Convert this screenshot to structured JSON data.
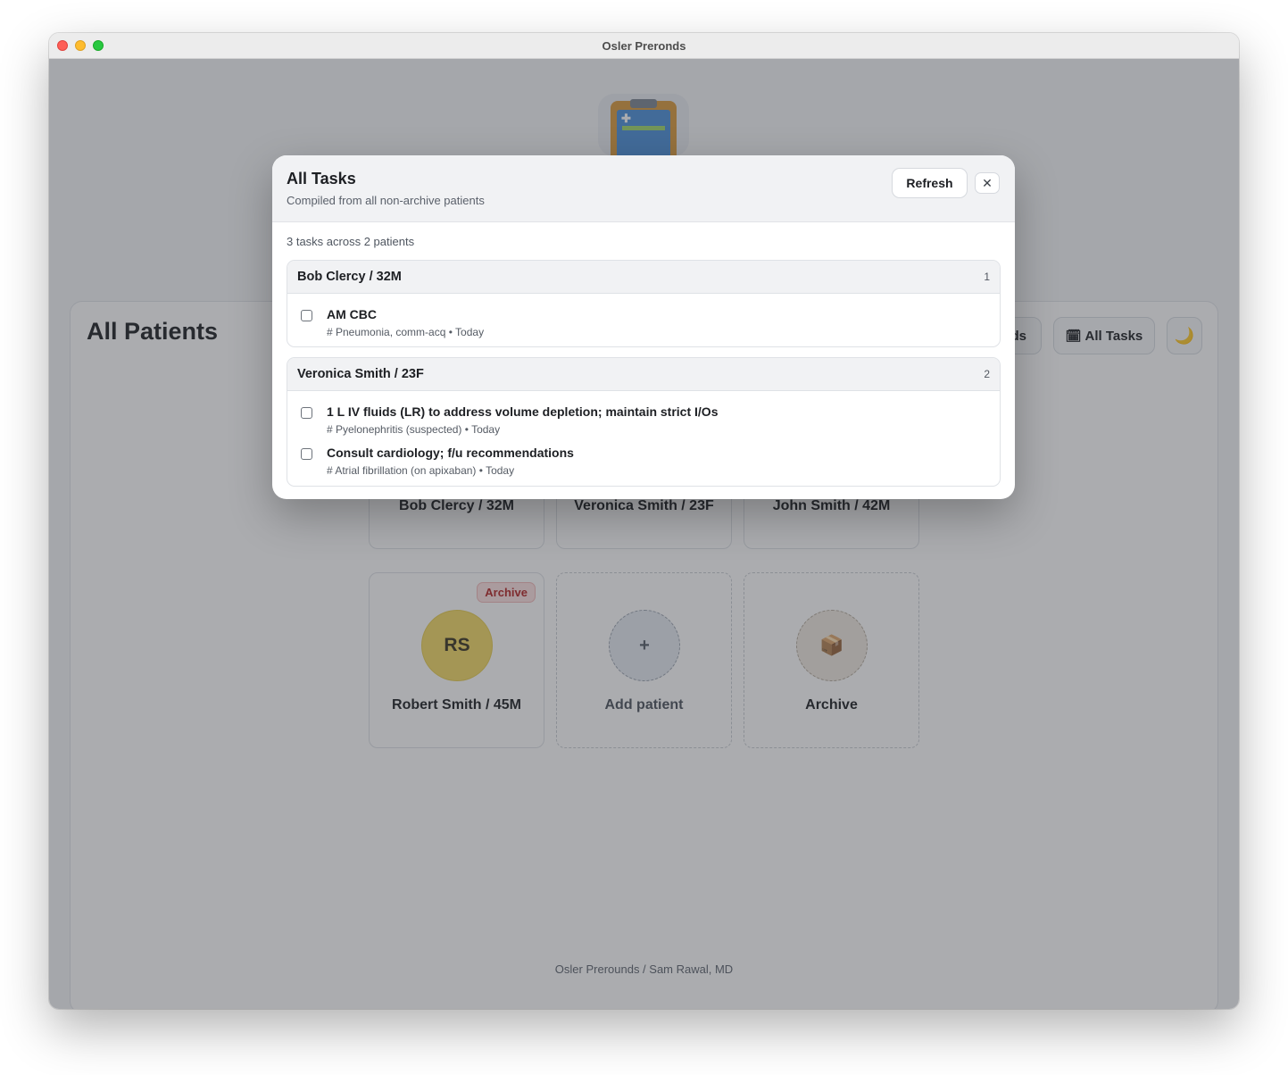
{
  "window": {
    "title": "Osler Preronds"
  },
  "app": {
    "logo_icon": "clipboard-icon"
  },
  "page": {
    "title": "All Patients",
    "buttons": {
      "hidden_partial_label": "ds",
      "all_tasks_label": "All Tasks",
      "all_tasks_icon": "calendar-icon",
      "theme_icon": "moon-icon"
    }
  },
  "patients": [
    {
      "name": "Bob Clercy / 32M"
    },
    {
      "name": "Veronica Smith / 23F"
    },
    {
      "name": "John Smith / 42M"
    },
    {
      "name": "Robert Smith / 45M",
      "initials": "RS",
      "badge": "Archive"
    }
  ],
  "add_card": {
    "icon": "+",
    "label": "Add patient"
  },
  "archive_card": {
    "icon": "📦",
    "label": "Archive"
  },
  "footer": {
    "credit": "Osler Prerounds / Sam Rawal, MD"
  },
  "modal": {
    "title": "All Tasks",
    "subtitle": "Compiled from all non-archive patients",
    "refresh_label": "Refresh",
    "close_icon": "✕",
    "summary": "3 tasks across 2 patients",
    "groups": [
      {
        "patient": "Bob Clercy / 32M",
        "count": "1",
        "tasks": [
          {
            "title": "AM CBC",
            "meta": "# Pneumonia, comm-acq • Today",
            "checked": false
          }
        ]
      },
      {
        "patient": "Veronica Smith / 23F",
        "count": "2",
        "tasks": [
          {
            "title": "1 L IV fluids (LR) to address volume depletion; maintain strict I/Os",
            "meta": "# Pyelonephritis (suspected) • Today",
            "checked": false
          },
          {
            "title": "Consult cardiology; f/u recommendations",
            "meta": "# Atrial fibrillation (on apixaban) • Today",
            "checked": false
          }
        ]
      }
    ]
  }
}
